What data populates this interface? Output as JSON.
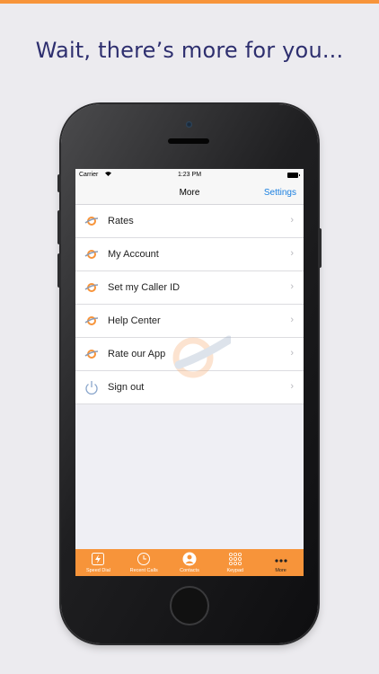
{
  "promo": {
    "headline": "Wait, there’s more for you..."
  },
  "status_bar": {
    "carrier": "Carrier",
    "time": "1:23 PM"
  },
  "nav": {
    "title": "More",
    "settings_label": "Settings"
  },
  "menu": {
    "items": [
      {
        "label": "Rates",
        "icon": "planet-ring-icon"
      },
      {
        "label": "My Account",
        "icon": "planet-ring-icon"
      },
      {
        "label": "Set my Caller ID",
        "icon": "planet-ring-icon"
      },
      {
        "label": "Help Center",
        "icon": "planet-ring-icon"
      },
      {
        "label": "Rate our App",
        "icon": "planet-ring-icon"
      },
      {
        "label": "Sign out",
        "icon": "power-icon"
      }
    ]
  },
  "tabs": [
    {
      "label": "Speed Dial",
      "icon": "lightning-icon"
    },
    {
      "label": "Recent Calls",
      "icon": "clock-icon"
    },
    {
      "label": "Contacts",
      "icon": "person-icon"
    },
    {
      "label": "Keypad",
      "icon": "keypad-icon"
    },
    {
      "label": "More",
      "icon": "more-dots-icon",
      "active": true
    }
  ],
  "colors": {
    "accent": "#f7943a",
    "link": "#1a7fe0",
    "headline": "#2e2f6f"
  }
}
